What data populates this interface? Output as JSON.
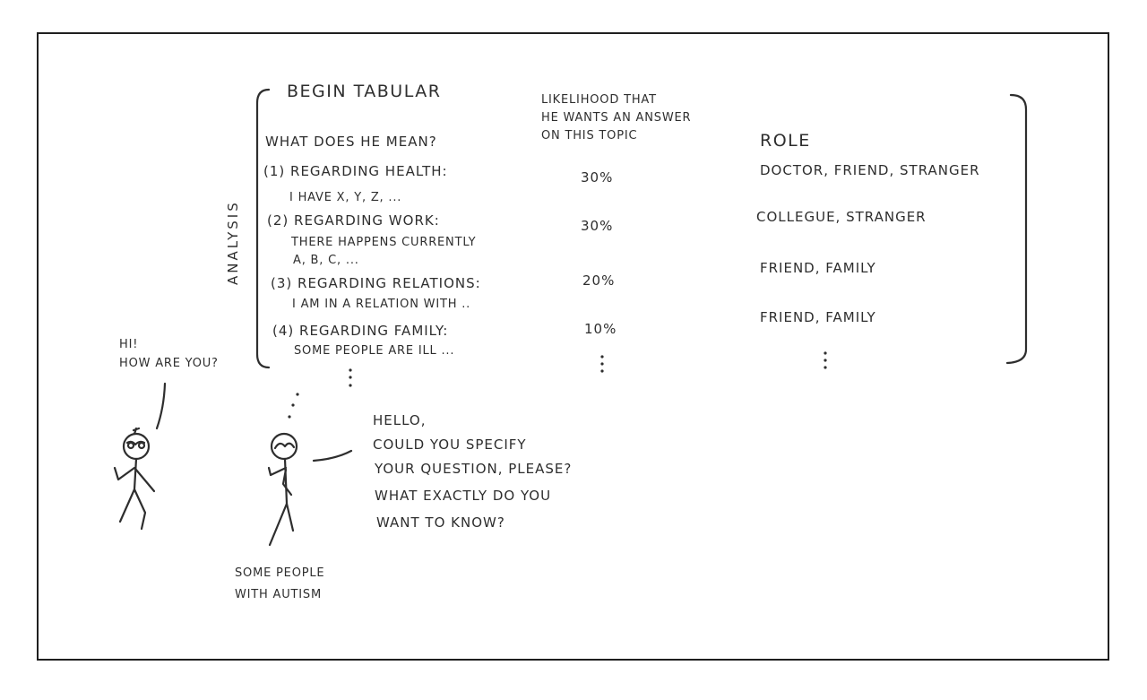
{
  "analysis": {
    "side_label": "ANALYSIS",
    "begin": "BEGIN TABULAR",
    "question_header": "WHAT DOES HE MEAN?",
    "likelihood_header": [
      "LIKELIHOOD THAT",
      "HE WANTS AN ANSWER",
      "ON THIS TOPIC"
    ],
    "role_header": "ROLE",
    "rows": [
      {
        "topic": "(1) REGARDING HEALTH:",
        "detail": "I HAVE X, Y, Z, ...",
        "detail2": "",
        "likelihood": "30%",
        "roles": "DOCTOR, FRIEND, STRANGER"
      },
      {
        "topic": "(2) REGARDING WORK:",
        "detail": "THERE HAPPENS CURRENTLY",
        "detail2": "A, B, C, ...",
        "likelihood": "30%",
        "roles": "COLLEGUE, STRANGER"
      },
      {
        "topic": "(3) REGARDING RELATIONS:",
        "detail": "I AM IN A RELATION WITH ..",
        "detail2": "",
        "likelihood": "20%",
        "roles": "FRIEND, FAMILY"
      },
      {
        "topic": "(4) REGARDING FAMILY:",
        "detail": "SOME PEOPLE ARE ILL ...",
        "detail2": "",
        "likelihood": "10%",
        "roles": "FRIEND, FAMILY"
      }
    ]
  },
  "left_person": {
    "speech": [
      "HI!",
      "HOW ARE YOU?"
    ]
  },
  "right_person": {
    "speech": [
      "HELLO,",
      "COULD YOU SPECIFY",
      "YOUR QUESTION, PLEASE?",
      "WHAT EXACTLY DO YOU",
      "WANT TO KNOW?"
    ],
    "caption": [
      "SOME PEOPLE",
      "WITH AUTISM"
    ]
  },
  "colors": {
    "ink": "#2e2e2e",
    "frame": "#1f1f1f",
    "background": "#ffffff"
  }
}
